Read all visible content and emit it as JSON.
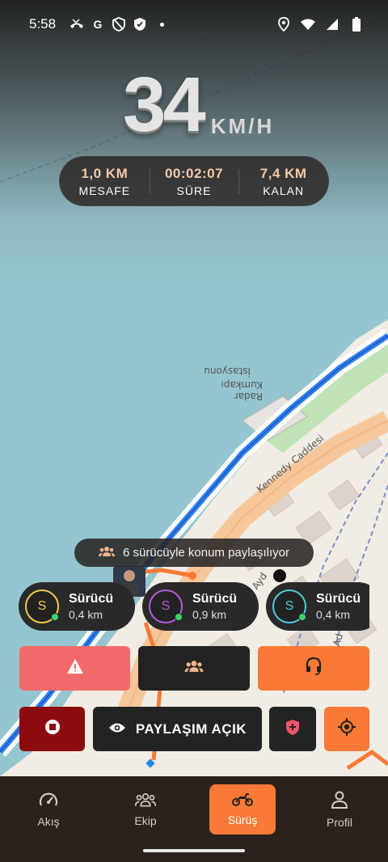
{
  "status_bar": {
    "time": "5:58",
    "left_icons": [
      "missed-call-icon",
      "google-icon",
      "shield-blocked-icon",
      "shield-check-icon",
      "notification-dot"
    ],
    "right_icons": [
      "location-icon",
      "wifi-icon",
      "signal-icon",
      "battery-icon"
    ]
  },
  "speed": {
    "value": "34",
    "unit": "KM/H"
  },
  "stats": [
    {
      "value": "1,0 KM",
      "label": "MESAFE"
    },
    {
      "value": "00:02:07",
      "label": "SÜRE"
    },
    {
      "value": "7,4 KM",
      "label": "KALAN"
    }
  ],
  "map": {
    "labels": {
      "station": "İstasyonu",
      "station_sub": "Kumkapı",
      "station_sub2": "Radar",
      "street": "Kennedy Caddesi",
      "street2": "Ayd",
      "street3": "Ad"
    }
  },
  "share_banner": {
    "text": "6 sürücüyle konum paylaşılıyor",
    "icon": "group-icon"
  },
  "riders": [
    {
      "initial": "S",
      "name": "Sürücü",
      "distance": "0,4 km",
      "color": "#f2c94c"
    },
    {
      "initial": "S",
      "name": "Sürücü",
      "distance": "0,9 km",
      "color": "#b45ad8"
    },
    {
      "initial": "S",
      "name": "Sürücü",
      "distance": "0,4 km",
      "color": "#4fc7d8"
    }
  ],
  "actions": {
    "alert_icon": "warning-icon",
    "team_icon": "group-icon",
    "support_icon": "headset-icon",
    "stop_icon": "stop-icon",
    "sharing_label": "PAYLAŞIM AÇIK",
    "sharing_icon": "eye-icon",
    "shield_icon": "medical-shield-icon",
    "locate_icon": "crosshair-icon"
  },
  "nav": {
    "items": [
      {
        "label": "Akış",
        "icon": "speedometer-icon"
      },
      {
        "label": "Ekip",
        "icon": "group-icon"
      },
      {
        "label": "Sürüş",
        "icon": "motorcycle-icon",
        "active": true
      },
      {
        "label": "Profil",
        "icon": "person-icon"
      }
    ]
  },
  "colors": {
    "accent": "#f97a36",
    "alert": "#f26b6b",
    "stop": "#8b0b0e",
    "nav_bg": "#2b211d"
  }
}
